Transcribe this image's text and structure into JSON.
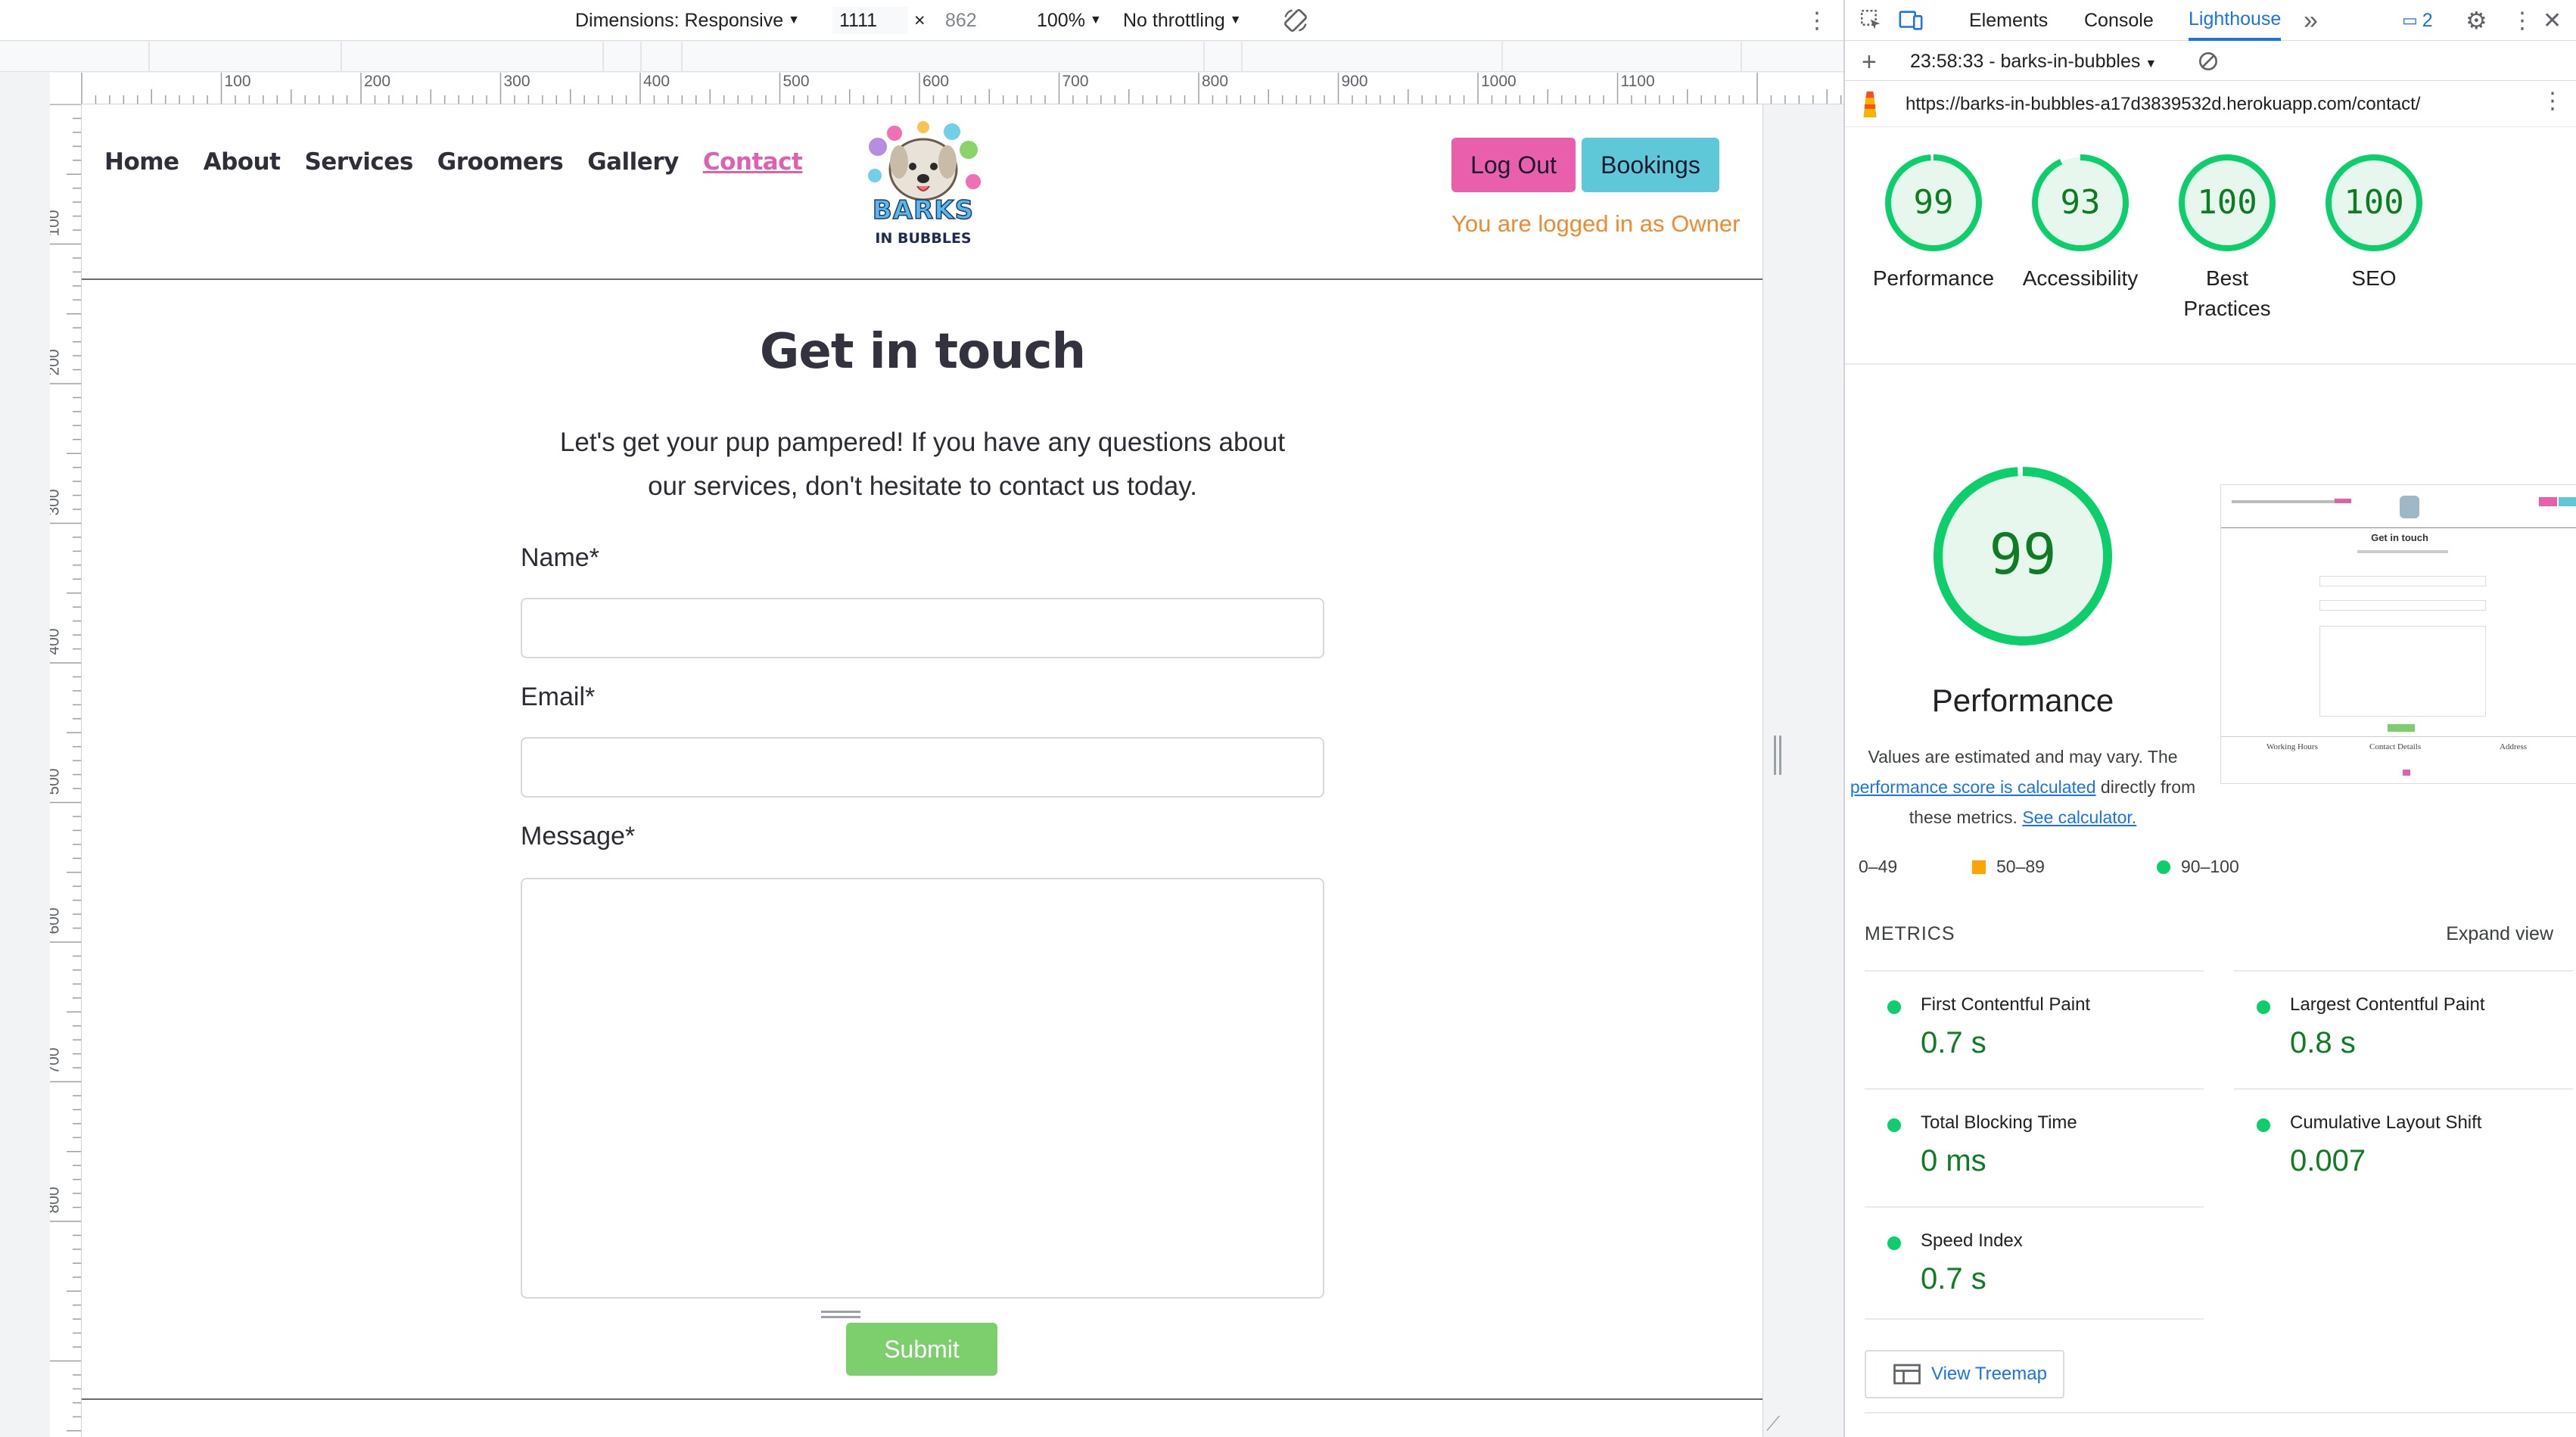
{
  "device_toolbar": {
    "dimensions_label": "Dimensions: Responsive",
    "width": "1111",
    "x": "×",
    "height": "862",
    "zoom": "100%",
    "throttle": "No throttling"
  },
  "rulers": {
    "h": [
      "100",
      "200",
      "300",
      "400",
      "500",
      "600",
      "700",
      "800",
      "900",
      "1000",
      "1100"
    ],
    "v": [
      "100",
      "200",
      "300",
      "400",
      "500",
      "600",
      "700",
      "800"
    ]
  },
  "site": {
    "nav": [
      "Home",
      "About",
      "Services",
      "Groomers",
      "Gallery",
      "Contact"
    ],
    "logo_text_1": "BARKS",
    "logo_text_2": "IN BUBBLES",
    "logout": "Log Out",
    "bookings": "Bookings",
    "logged_in": "You are logged in as Owner",
    "title": "Get in touch",
    "intro": "Let's get your pup pampered! If you have any questions about our services, don't hesitate to contact us today.",
    "name_label": "Name*",
    "email_label": "Email*",
    "message_label": "Message*",
    "submit": "Submit"
  },
  "devtools": {
    "tabs": [
      "Elements",
      "Console",
      "Lighthouse"
    ],
    "more": "»",
    "issues_count": "2",
    "report_time": "23:58:33 - barks-in-bubbles",
    "url": "https://barks-in-bubbles-a17d3839532d.herokuapp.com/contact/",
    "scores": [
      {
        "value": "99",
        "label": "Performance",
        "pct": 0.99
      },
      {
        "value": "93",
        "label": "Accessibility",
        "pct": 0.93
      },
      {
        "value": "100",
        "label": "Best Practices",
        "pct": 1.0
      },
      {
        "value": "100",
        "label": "SEO",
        "pct": 1.0
      }
    ],
    "perf_score": "99",
    "perf_title": "Performance",
    "perf_desc_1": "Values are estimated and may vary. The ",
    "perf_desc_link1": "performance score is calculated",
    "perf_desc_2": " directly from these metrics. ",
    "perf_desc_link2": "See calculator.",
    "legend": [
      "0–49",
      "50–89",
      "90–100"
    ],
    "metrics_header": "METRICS",
    "expand_view": "Expand view",
    "metrics": [
      {
        "name": "First Contentful Paint",
        "value": "0.7 s"
      },
      {
        "name": "Largest Contentful Paint",
        "value": "0.8 s"
      },
      {
        "name": "Total Blocking Time",
        "value": "0 ms"
      },
      {
        "name": "Cumulative Layout Shift",
        "value": "0.007"
      },
      {
        "name": "Speed Index",
        "value": "0.7 s"
      }
    ],
    "treemap": "View Treemap",
    "thumb": {
      "title": "Get in touch",
      "footer": [
        "Working Hours",
        "Contact Details",
        "Address"
      ]
    }
  },
  "colors": {
    "accent_pink": "#ea5fac",
    "accent_cyan": "#5ec8d8",
    "owner_orange": "#ef8a2e",
    "submit_green": "#7ccf6c",
    "score_green": "#0cce6b",
    "devtools_blue": "#1a73e8"
  }
}
